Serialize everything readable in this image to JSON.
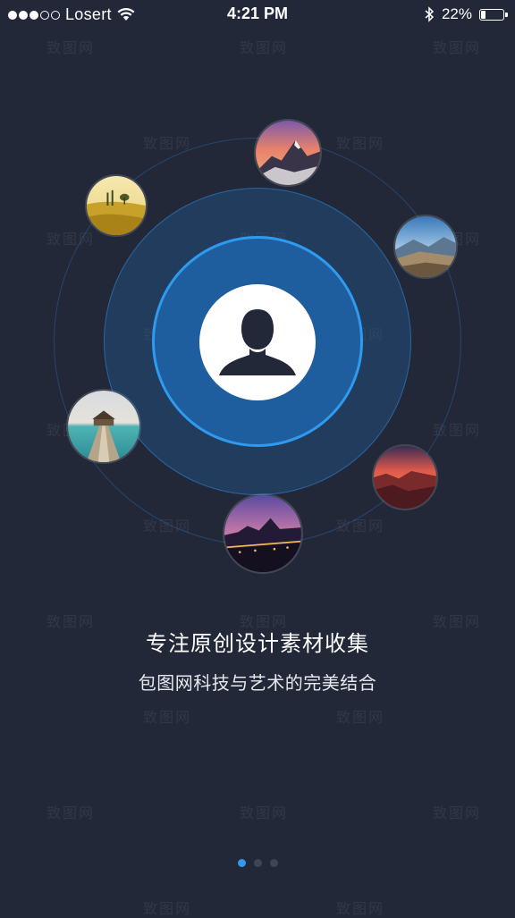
{
  "status_bar": {
    "carrier": "Losert",
    "time": "4:21 PM",
    "battery_percent": "22%",
    "battery_level": 0.22,
    "signal_bars_filled": 3,
    "signal_bars_total": 5
  },
  "onboarding": {
    "title": "专注原创设计素材收集",
    "subtitle": "包图网科技与艺术的完美结合"
  },
  "photos": [
    "mountain-sunset",
    "wheat-field",
    "valley-sunrays",
    "sea-pier",
    "canyon-sunset",
    "city-night"
  ],
  "pager": {
    "count": 3,
    "active_index": 0
  },
  "watermark": "致图网",
  "colors": {
    "background": "#232838",
    "accent": "#2e9af0",
    "inner_circle": "#1f5e9e"
  }
}
